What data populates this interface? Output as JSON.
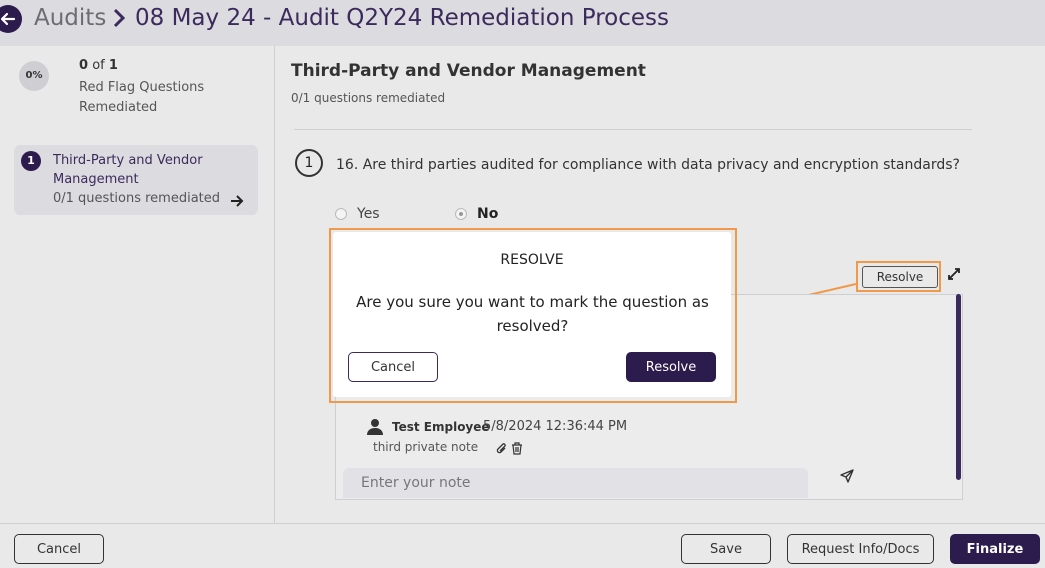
{
  "header": {
    "breadcrumb_root": "Audits",
    "title": "08 May 24 - Audit Q2Y24 Remediation Process"
  },
  "sidebar": {
    "progress_percent": "0%",
    "progress_done": "0",
    "progress_of": "of",
    "progress_total": "1",
    "progress_label": "Red Flag Questions Remediated",
    "sections": [
      {
        "number": "1",
        "title": "Third-Party and Vendor Management",
        "status": "0/1 questions remediated"
      }
    ]
  },
  "main": {
    "section_title": "Third-Party and Vendor Management",
    "section_status": "0/1 questions remediated",
    "question": {
      "number": "1",
      "text": "16. Are third parties audited for compliance with data privacy and encryption standards?",
      "options": [
        {
          "label": "Yes",
          "selected": false
        },
        {
          "label": "No",
          "selected": true
        }
      ]
    },
    "resolve_label": "Resolve",
    "note": {
      "author": "Test Employee",
      "timestamp": "5/8/2024 12:36:44 PM",
      "text": "third private note"
    },
    "note_input_placeholder": "Enter your note"
  },
  "footer": {
    "cancel_label": "Cancel",
    "save_label": "Save",
    "request_label": "Request Info/Docs",
    "finalize_label": "Finalize"
  },
  "modal": {
    "title": "RESOLVE",
    "message": "Are you sure you want to mark the question as resolved?",
    "cancel_label": "Cancel",
    "confirm_label": "Resolve"
  },
  "colors": {
    "brand_dark": "#2c1b4d",
    "highlight": "#f0994a"
  }
}
